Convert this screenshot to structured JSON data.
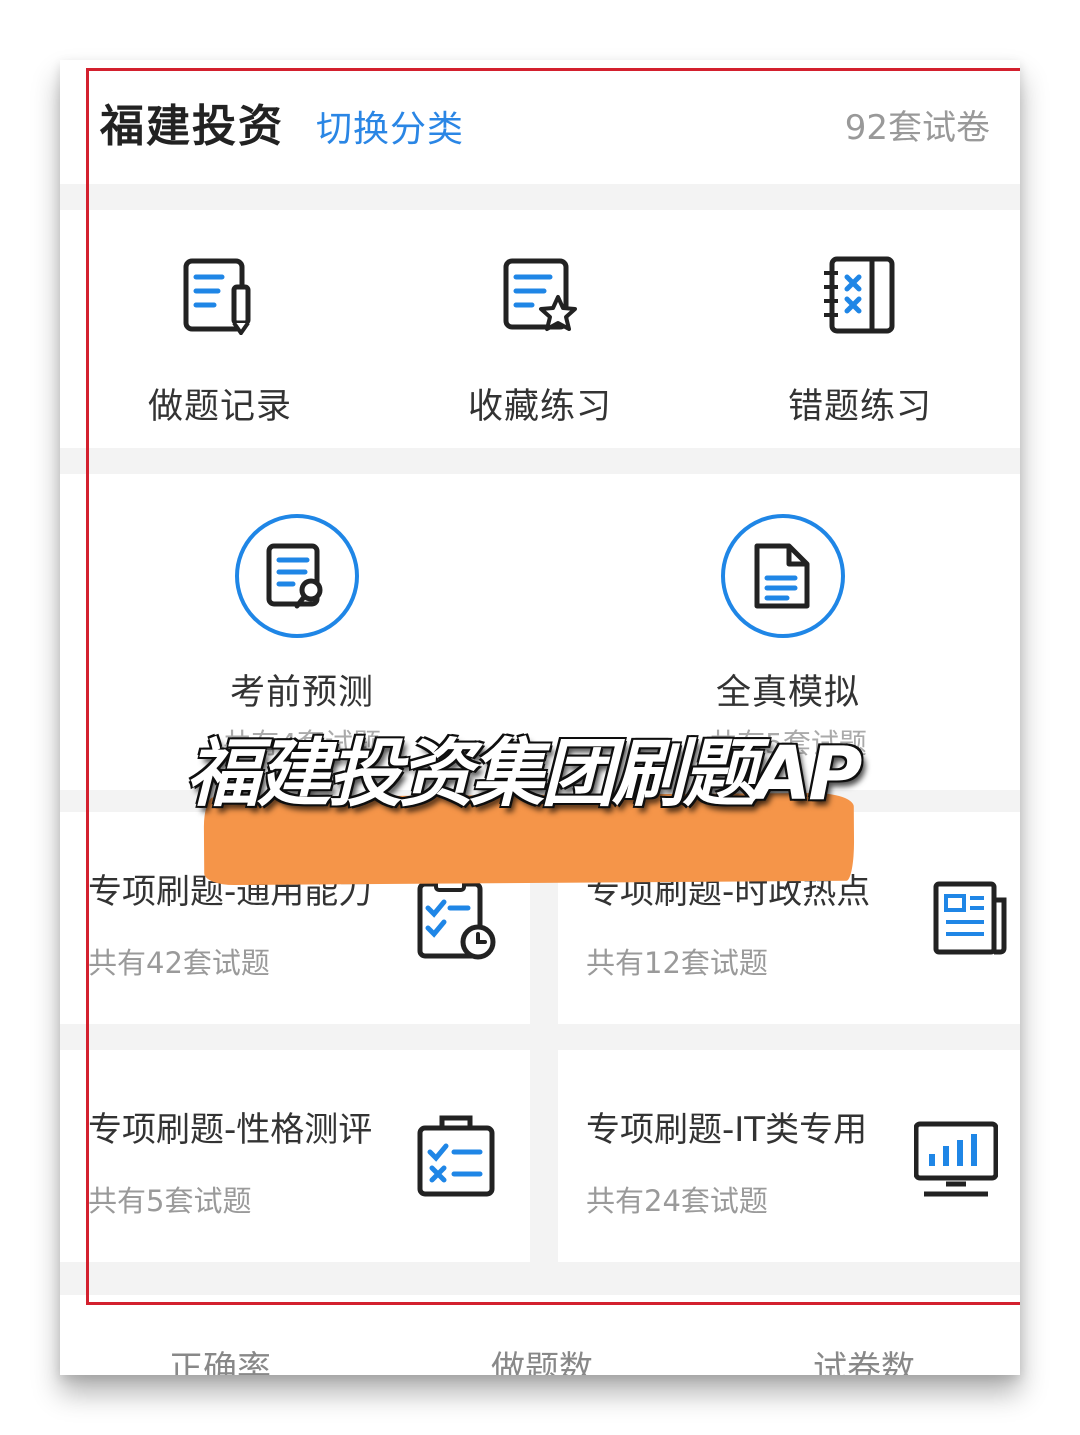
{
  "header": {
    "title": "福建投资",
    "switch_label": "切换分类",
    "paper_count": "92套试卷"
  },
  "tools": [
    {
      "label": "做题记录",
      "icon": "edit-record-icon"
    },
    {
      "label": "收藏练习",
      "icon": "favorite-doc-icon"
    },
    {
      "label": "错题练习",
      "icon": "wrong-questions-icon"
    }
  ],
  "modes": [
    {
      "label": "考前预测",
      "sub": "共有4套试题",
      "icon": "search-doc-icon"
    },
    {
      "label": "全真模拟",
      "sub": "共有5套试题",
      "icon": "document-icon"
    }
  ],
  "practice": [
    {
      "title": "专项刷题-通用能力",
      "sub": "共有42套试题",
      "icon": "checklist-clock-icon"
    },
    {
      "title": "专项刷题-时政热点",
      "sub": "共有12套试题",
      "icon": "newspaper-icon"
    },
    {
      "title": "专项刷题-性格测评",
      "sub": "共有5套试题",
      "icon": "clipboard-check-icon"
    },
    {
      "title": "专项刷题-IT类专用",
      "sub": "共有24套试题",
      "icon": "monitor-chart-icon"
    }
  ],
  "stats": {
    "accuracy": "正确率",
    "questions_done": "做题数",
    "papers": "试卷数"
  },
  "overlay": {
    "caption": "福建投资集团刷题AP"
  },
  "colors": {
    "accent": "#1f86e6",
    "highlight_border": "#d3202e",
    "brush": "#f59549"
  }
}
